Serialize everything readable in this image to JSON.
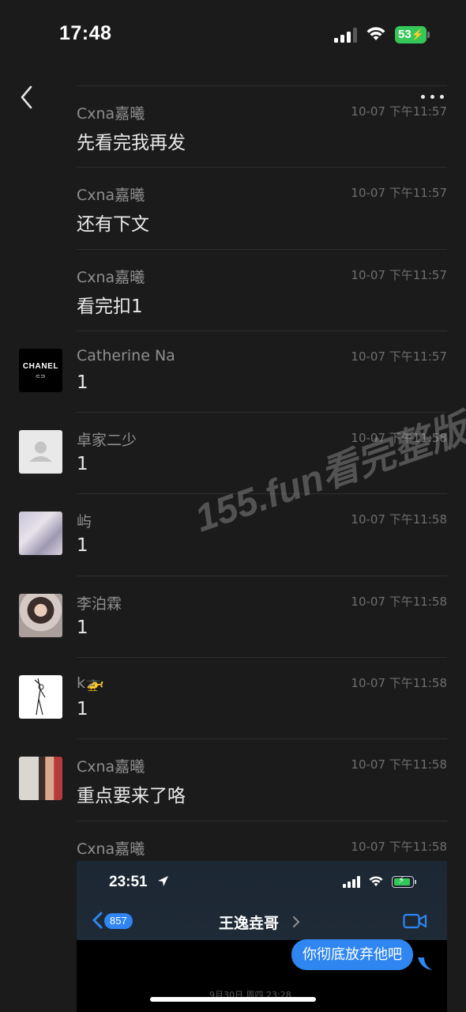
{
  "status_bar": {
    "time": "17:48",
    "battery": "53"
  },
  "nav": {
    "back_icon": "chevron-left-icon",
    "more_icon": "ellipsis-icon"
  },
  "messages": [
    {
      "name": "Cxna嘉曦",
      "time": "10-07 下午11:57",
      "text": "先看完我再发",
      "avatar": "none"
    },
    {
      "name": "Cxna嘉曦",
      "time": "10-07 下午11:57",
      "text": "还有下文",
      "avatar": "none"
    },
    {
      "name": "Cxna嘉曦",
      "time": "10-07 下午11:57",
      "text": "看完扣1",
      "avatar": "none"
    },
    {
      "name": "Catherine Na",
      "time": "10-07 下午11:57",
      "text": "1",
      "avatar": "chanel-logo",
      "avatar_text": "CHANEL"
    },
    {
      "name": "卓家二少",
      "time": "10-07 下午11:58",
      "text": "1",
      "avatar": "default-person"
    },
    {
      "name": "屿",
      "time": "10-07 下午11:58",
      "text": "1",
      "avatar": "photo"
    },
    {
      "name": "李泊霖",
      "time": "10-07 下午11:58",
      "text": "1",
      "avatar": "photo"
    },
    {
      "name": "k🚁",
      "time": "10-07 下午11:58",
      "text": "1",
      "avatar": "sketch"
    },
    {
      "name": "Cxna嘉曦",
      "time": "10-07 下午11:58",
      "text": "重点要来了咯",
      "avatar": "photo"
    },
    {
      "name": "Cxna嘉曦",
      "time": "10-07 下午11:58",
      "text": "",
      "avatar": "none"
    }
  ],
  "watermark": "155.fun看完整版",
  "embedded": {
    "time": "23:51",
    "back_count": "857",
    "contact_name": "王逸垚哥",
    "bubble_text": "你彻底放弃他吧",
    "date_text": "9月30日 周四 23:28",
    "accent_color": "#2f86f0"
  },
  "colors": {
    "background": "#1b1b1b",
    "name": "#8f8f8f",
    "time": "#6e6e6e",
    "text": "#eaeaea",
    "battery": "#35c759"
  }
}
